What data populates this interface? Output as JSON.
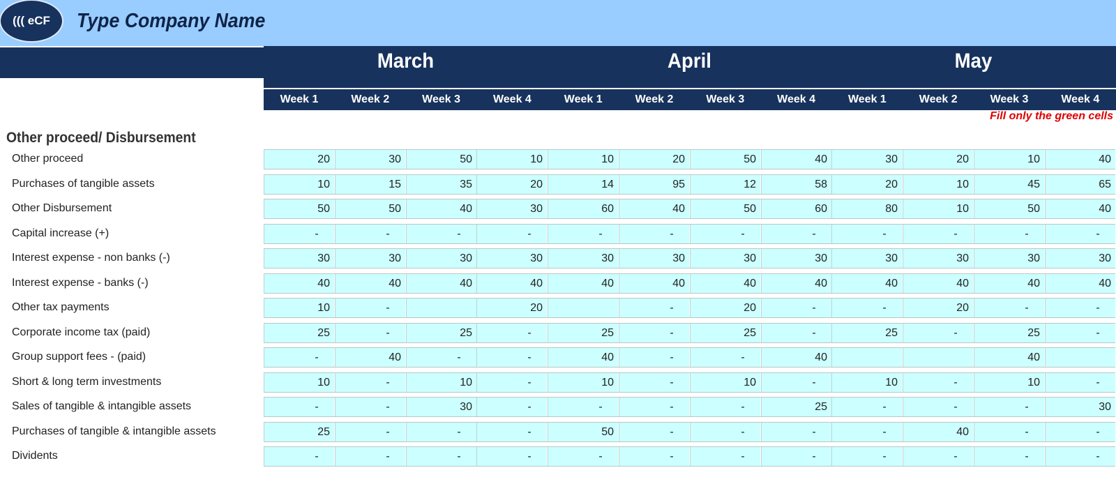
{
  "header": {
    "logo_text": "((( eCF",
    "company_name": "Type Company Name",
    "months": [
      "March",
      "April",
      "May"
    ],
    "weeks": [
      "Week 1",
      "Week 2",
      "Week 3",
      "Week 4",
      "Week 1",
      "Week 2",
      "Week 3",
      "Week 4",
      "Week 1",
      "Week 2",
      "Week 3",
      "Week 4"
    ],
    "note": "Fill only the green cells"
  },
  "section": {
    "title": "Other proceed/ Disbursement"
  },
  "rows": [
    {
      "label": "Other proceed",
      "values": [
        "20",
        "30",
        "50",
        "10",
        "10",
        "20",
        "50",
        "40",
        "30",
        "20",
        "10",
        "40"
      ]
    },
    {
      "label": "Purchases of tangible assets",
      "values": [
        "10",
        "15",
        "35",
        "20",
        "14",
        "95",
        "12",
        "58",
        "20",
        "10",
        "45",
        "65"
      ]
    },
    {
      "label": "Other Disbursement",
      "values": [
        "50",
        "50",
        "40",
        "30",
        "60",
        "40",
        "50",
        "60",
        "80",
        "10",
        "50",
        "40"
      ]
    },
    {
      "label": "Capital increase (+)",
      "values": [
        "-",
        "-",
        "-",
        "-",
        "-",
        "-",
        "-",
        "-",
        "-",
        "-",
        "-",
        "-"
      ]
    },
    {
      "label": "Interest expense - non banks (-)",
      "values": [
        "30",
        "30",
        "30",
        "30",
        "30",
        "30",
        "30",
        "30",
        "30",
        "30",
        "30",
        "30"
      ]
    },
    {
      "label": "Interest expense - banks (-)",
      "values": [
        "40",
        "40",
        "40",
        "40",
        "40",
        "40",
        "40",
        "40",
        "40",
        "40",
        "40",
        "40"
      ]
    },
    {
      "label": "Other tax payments",
      "values": [
        "10",
        "-",
        "",
        "20",
        "",
        "-",
        "20",
        "-",
        "-",
        "20",
        "-",
        "-"
      ]
    },
    {
      "label": "Corporate income tax (paid)",
      "values": [
        "25",
        "-",
        "25",
        "-",
        "25",
        "-",
        "25",
        "-",
        "25",
        "-",
        "25",
        "-"
      ]
    },
    {
      "label": "Group support fees - (paid)",
      "values": [
        "-",
        "40",
        "-",
        "-",
        "40",
        "-",
        "-",
        "40",
        "",
        "",
        "40",
        ""
      ]
    },
    {
      "label": "Short & long term investments",
      "values": [
        "10",
        "-",
        "10",
        "-",
        "10",
        "-",
        "10",
        "-",
        "10",
        "-",
        "10",
        "-"
      ]
    },
    {
      "label": "Sales of tangible & intangible assets",
      "values": [
        "-",
        "-",
        "30",
        "-",
        "-",
        "-",
        "-",
        "25",
        "-",
        "-",
        "-",
        "30"
      ]
    },
    {
      "label": "Purchases of tangible & intangible assets",
      "values": [
        "25",
        "-",
        "-",
        "-",
        "50",
        "-",
        "-",
        "-",
        "-",
        "40",
        "-",
        "-"
      ]
    },
    {
      "label": "Dividents",
      "values": [
        "-",
        "-",
        "-",
        "-",
        "-",
        "-",
        "-",
        "-",
        "-",
        "-",
        "-",
        "-"
      ]
    }
  ],
  "colors": {
    "banner": "#99ccff",
    "navy": "#17325c",
    "input_cell": "#ccffff",
    "note": "#e00000"
  }
}
